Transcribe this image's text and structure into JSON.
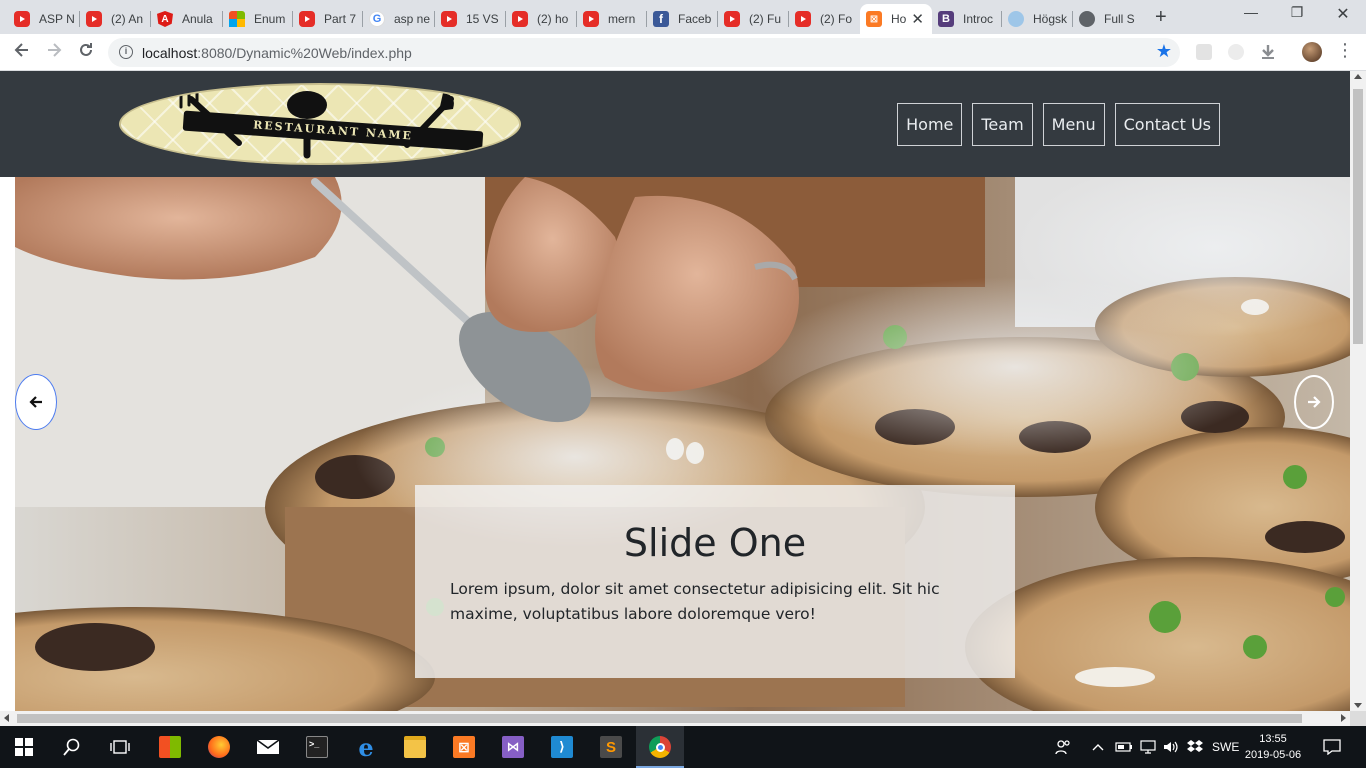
{
  "browser": {
    "tabs": [
      {
        "title": "ASP N",
        "icon": "youtube-icon"
      },
      {
        "title": "(2) An",
        "icon": "youtube-icon"
      },
      {
        "title": "Anula",
        "icon": "angular-icon"
      },
      {
        "title": "Enum",
        "icon": "microsoft-icon"
      },
      {
        "title": "Part 7",
        "icon": "youtube-icon"
      },
      {
        "title": "asp ne",
        "icon": "google-icon"
      },
      {
        "title": "15 VS",
        "icon": "youtube-icon"
      },
      {
        "title": "(2) ho",
        "icon": "youtube-icon"
      },
      {
        "title": "mern",
        "icon": "youtube-icon"
      },
      {
        "title": "Faceb",
        "icon": "facebook-icon"
      },
      {
        "title": "(2) Fu",
        "icon": "youtube-icon"
      },
      {
        "title": "(2) Fo",
        "icon": "youtube-icon"
      },
      {
        "title": "Ho",
        "icon": "xampp-icon",
        "active": true
      },
      {
        "title": "Introc",
        "icon": "bootstrap-icon"
      },
      {
        "title": "Högsk",
        "icon": "cloud-icon"
      },
      {
        "title": "Full S",
        "icon": "globe-icon"
      }
    ],
    "url_host": "localhost",
    "url_rest": ":8080/Dynamic%20Web/index.php"
  },
  "site": {
    "logo_text": "RESTAURANT NAME",
    "nav": [
      "Home",
      "Team",
      "Menu",
      "Contact Us"
    ]
  },
  "carousel": {
    "title": "Slide One",
    "text": "Lorem ipsum, dolor sit amet consectetur adipisicing elit. Sit hic maxime, voluptatibus labore doloremque vero!"
  },
  "taskbar": {
    "language": "SWE",
    "time": "13:55",
    "date": "2019-05-06"
  },
  "colors": {
    "header_bg": "#343a40",
    "logo_bg": "#ece6b4",
    "taskbar_bg": "#101418",
    "bookmark_star": "#1a73e8"
  }
}
